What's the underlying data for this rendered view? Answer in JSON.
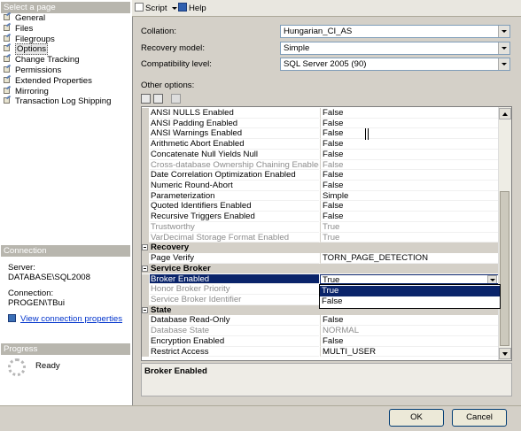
{
  "left": {
    "select_page_header": "Select a page",
    "pages": [
      {
        "label": "General",
        "selected": false
      },
      {
        "label": "Files",
        "selected": false
      },
      {
        "label": "Filegroups",
        "selected": false
      },
      {
        "label": "Options",
        "selected": true
      },
      {
        "label": "Change Tracking",
        "selected": false
      },
      {
        "label": "Permissions",
        "selected": false
      },
      {
        "label": "Extended Properties",
        "selected": false
      },
      {
        "label": "Mirroring",
        "selected": false
      },
      {
        "label": "Transaction Log Shipping",
        "selected": false
      }
    ],
    "connection_header": "Connection",
    "server_label": "Server:",
    "server_value": "DATABASE\\SQL2008",
    "connection_label": "Connection:",
    "connection_value": "PROGEN\\TBui",
    "view_props_link": "View connection properties",
    "progress_header": "Progress",
    "progress_status": "Ready"
  },
  "toolbar": {
    "script_label": "Script",
    "help_label": "Help"
  },
  "form": {
    "collation_label": "Collation:",
    "collation_value": "Hungarian_CI_AS",
    "recovery_label": "Recovery model:",
    "recovery_value": "Simple",
    "compat_label": "Compatibility level:",
    "compat_value": "SQL Server 2005 (90)",
    "other_options_label": "Other options:"
  },
  "grid": {
    "rows": [
      {
        "kind": "row",
        "name": "ANSI NULLS Enabled",
        "value": "False"
      },
      {
        "kind": "row",
        "name": "ANSI Padding Enabled",
        "value": "False"
      },
      {
        "kind": "row",
        "name": "ANSI Warnings Enabled",
        "value": "False"
      },
      {
        "kind": "row",
        "name": "Arithmetic Abort Enabled",
        "value": "False"
      },
      {
        "kind": "row",
        "name": "Concatenate Null Yields Null",
        "value": "False"
      },
      {
        "kind": "row",
        "name": "Cross-database Ownership Chaining Enabled",
        "value": "False",
        "disabled": true
      },
      {
        "kind": "row",
        "name": "Date Correlation Optimization Enabled",
        "value": "False"
      },
      {
        "kind": "row",
        "name": "Numeric Round-Abort",
        "value": "False"
      },
      {
        "kind": "row",
        "name": "Parameterization",
        "value": "Simple"
      },
      {
        "kind": "row",
        "name": "Quoted Identifiers Enabled",
        "value": "False"
      },
      {
        "kind": "row",
        "name": "Recursive Triggers Enabled",
        "value": "False"
      },
      {
        "kind": "row",
        "name": "Trustworthy",
        "value": "True",
        "disabled": true
      },
      {
        "kind": "row",
        "name": "VarDecimal Storage Format Enabled",
        "value": "True",
        "disabled": true
      },
      {
        "kind": "category",
        "name": "Recovery"
      },
      {
        "kind": "row",
        "name": "Page Verify",
        "value": "TORN_PAGE_DETECTION"
      },
      {
        "kind": "category",
        "name": "Service Broker"
      },
      {
        "kind": "row",
        "name": "Broker Enabled",
        "value": "True",
        "selected": true
      },
      {
        "kind": "row",
        "name": "Honor Broker Priority",
        "value": "",
        "disabled": true
      },
      {
        "kind": "row",
        "name": "Service Broker Identifier",
        "value": "",
        "disabled": true
      },
      {
        "kind": "category",
        "name": "State"
      },
      {
        "kind": "row",
        "name": "Database Read-Only",
        "value": "False"
      },
      {
        "kind": "row",
        "name": "Database State",
        "value": "NORMAL",
        "disabled": true
      },
      {
        "kind": "row",
        "name": "Encryption Enabled",
        "value": "False"
      },
      {
        "kind": "row",
        "name": "Restrict Access",
        "value": "MULTI_USER"
      }
    ],
    "dropdown_options": [
      "True",
      "False"
    ],
    "dropdown_highlighted": "True"
  },
  "description": {
    "title": "Broker Enabled"
  },
  "buttons": {
    "ok": "OK",
    "cancel": "Cancel"
  },
  "colors": {
    "selection": "#0a246a",
    "link": "#0033cc",
    "panel": "#d4d0c8"
  }
}
